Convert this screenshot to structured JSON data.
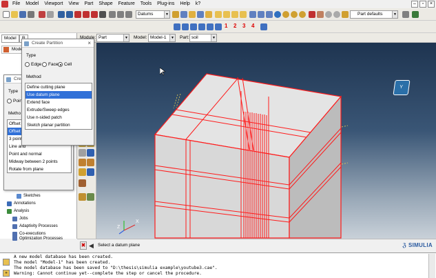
{
  "menubar": {
    "items": [
      "File",
      "Model",
      "Viewport",
      "View",
      "Part",
      "Shape",
      "Feature",
      "Tools",
      "Plug-ins",
      "Help",
      "k?"
    ]
  },
  "toolbar": {
    "datums_combo": "Datums",
    "part_defaults_combo": "Part defaults",
    "partition_numbers": [
      "1",
      "2",
      "3",
      "4"
    ]
  },
  "context": {
    "module_label": "Module:",
    "module_value": "Part",
    "model_label": "Model:",
    "model_value": "Model-1",
    "part_label": "Part:",
    "part_value": "soil"
  },
  "left_panel": {
    "tab_model": "Model",
    "tab_results": "R",
    "model_tree_label": "Model",
    "tree_items": [
      {
        "label": "Sketches",
        "indent": 1
      },
      {
        "label": "Annotations",
        "indent": 0
      },
      {
        "label": "Analysis",
        "indent": 0
      },
      {
        "label": "Jobs",
        "indent": 1
      },
      {
        "label": "Adaptivity Processes",
        "indent": 1
      },
      {
        "label": "Co-executions",
        "indent": 1
      },
      {
        "label": "Optimization Processes",
        "indent": 1
      }
    ]
  },
  "partition_dialog": {
    "title": "Create Partition",
    "type_label": "Type",
    "type_options": [
      "Edge",
      "Face",
      "Cell"
    ],
    "type_selected": "Cell",
    "method_label": "Method",
    "methods": [
      "Define cutting plane",
      "Use datum plane",
      "Extend face",
      "Extrude/Sweep edges",
      "Use n-sided patch",
      "Sketch planar partition"
    ],
    "method_selected": "Use datum plane"
  },
  "datum_dialog": {
    "title": "Crea",
    "type_label": "Type",
    "type_option": "Point",
    "method_label": "Metho",
    "methods": [
      "Offset f",
      "Offset f",
      "3 points",
      "Line and",
      "Point and normal",
      "Midway between 2 points",
      "Rotate from plane"
    ],
    "method_selected": "Offset f"
  },
  "viewport": {
    "axis_z": "Z",
    "axis_x": "X",
    "triad_label": "Y",
    "brand": "SIMULIA"
  },
  "prompt": {
    "text": "Select a datum plane"
  },
  "messages": [
    "A new model database has been created.",
    "The model \"Model-1\" has been created.",
    "The model database has been saved to \"D:\\thesis\\simulia example\\youtube3.cae\".",
    "Warning: Cannot continue yet--complete the step or cancel the procedure."
  ],
  "colors": {
    "accent_select": "#3070d8",
    "partition_red": "#ff1a1a",
    "viewport_top": "#1e3450"
  }
}
